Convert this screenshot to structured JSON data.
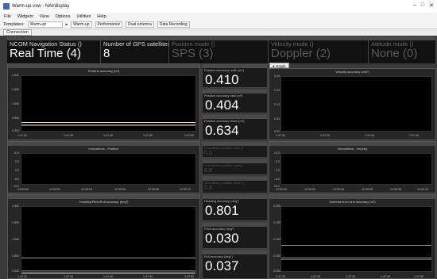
{
  "app": {
    "title": "Warm-up.vxw - NAVdisplay"
  },
  "menu": [
    "File",
    "Widgets",
    "View",
    "Options",
    "Utilities",
    "Help"
  ],
  "toolbar": {
    "templates_label": "Templates:",
    "template_value": "Warm-up",
    "buttons": [
      "Warm-up",
      "Performance",
      "Dual antenna",
      "Data Recording"
    ]
  },
  "connection_tab": "Connection",
  "status": [
    {
      "label": "NCOM Navigation Status ()",
      "value": "Real Time (4)"
    },
    {
      "label": "Number of GPS satellites used ()",
      "value": "8"
    },
    {
      "label": "Position mode ()",
      "value": "SPS (3)"
    },
    {
      "label": "Velocity mode ()",
      "value": "Doppler (2)"
    },
    {
      "label": "Attitude mode ()",
      "value": "None (0)"
    }
  ],
  "graph_tab": "Graph",
  "graphs": {
    "pos_acc": {
      "title": "Position accuracy (m¹)",
      "yticks": [
        "2.000",
        "1.500",
        "1.000",
        "0.500",
        "0.000"
      ],
      "xticks": [
        "1:47:32",
        "1:47:35",
        "1:47:40",
        "1:47:45",
        "1:47:50"
      ]
    },
    "vel_acc": {
      "title": "Velocity accuracy (m/s¹)",
      "yticks": [
        "0.20",
        "0.15",
        "0.10",
        "0.05",
        "0.00"
      ],
      "xticks": [
        "1:47:32",
        "1:47:35",
        "1:47:40",
        "1:47:45"
      ]
    },
    "innov_pos": {
      "title": "Innovations - Position",
      "yticks": [
        "10.0",
        "5.0",
        "0.0",
        "-5.0",
        "-10.0"
      ],
      "xticks": [
        "12:00:00",
        "12:00:02",
        "12:00:04",
        "12:00:06",
        "12:00:08",
        "12:00:10"
      ]
    },
    "innov_vel": {
      "title": "Innovations - Velocity",
      "yticks": [
        "10.0",
        "5.0",
        "0.0",
        "-5.0",
        "-10.0"
      ],
      "xticks": [
        "12:00:00",
        "12:00:02",
        "12:00:04",
        "12:00:06",
        "12:00:08",
        "12:00:10"
      ]
    },
    "hpr_acc": {
      "title": "Heading/Pitch/Roll accuracy (deg¹)",
      "yticks": [
        "2.000",
        "1.500",
        "1.000",
        "0.500",
        "0.000"
      ],
      "xticks": [
        "1:47:32",
        "1:47:35",
        "1:47:40",
        "1:47:45",
        "1:47:50"
      ]
    },
    "ant_acc": {
      "title": "Antenna lever arm accuracy (m¹)",
      "yticks": [
        "0.200",
        "0.150",
        "0.100",
        "0.050",
        "0.000"
      ],
      "xticks": [
        "1:47:32",
        "1:47:35",
        "1:47:40",
        "1:47:45",
        "1:47:50"
      ]
    }
  },
  "numbers": [
    {
      "label": "Position accuracy north (m¹)",
      "value": "0.410"
    },
    {
      "label": "Position accuracy east (m¹)",
      "value": "0.404"
    },
    {
      "label": "Position accuracy down (m¹)",
      "value": "0.634"
    },
    {
      "label": "Innovations position north ()",
      "value": "0.0"
    },
    {
      "label": "Innovations position east ()",
      "value": "0.0"
    },
    {
      "label": "Innovations position down ()",
      "value": "0.0"
    },
    {
      "label": "Heading accuracy (deg¹)",
      "value": "0.801"
    },
    {
      "label": "Pitch accuracy (deg¹)",
      "value": "0.030"
    },
    {
      "label": "Roll accuracy (deg¹)",
      "value": "0.037"
    }
  ],
  "colors": {
    "trace_white": "#e8e8e8",
    "trace_grey": "#9a9a9a",
    "trace_orange": "#c8a060"
  }
}
